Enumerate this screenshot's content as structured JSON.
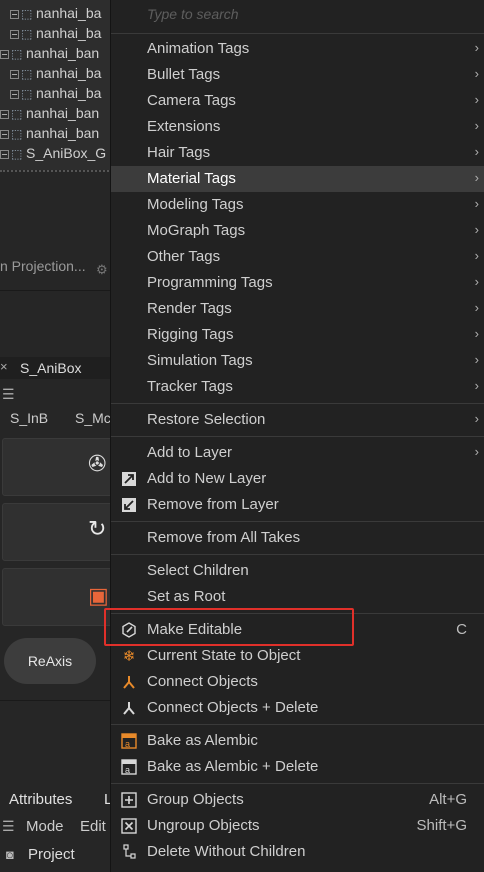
{
  "tree": {
    "rows": [
      {
        "label": "nanhai_ba",
        "indent": 1
      },
      {
        "label": "nanhai_ba",
        "indent": 1
      },
      {
        "label": "nanhai_ban",
        "indent": 0
      },
      {
        "label": "nanhai_ba",
        "indent": 1
      },
      {
        "label": "nanhai_ba",
        "indent": 1
      },
      {
        "label": "nanhai_ban",
        "indent": 0
      },
      {
        "label": "nanhai_ban",
        "indent": 0
      },
      {
        "label": "S_AniBox_G",
        "indent": 0
      }
    ],
    "projection_label": "n Projection..."
  },
  "left_panel": {
    "tab_label": "S_AniBox",
    "tab_close": "×",
    "sinb": "S_InB",
    "smo": "S_Mc",
    "reaxis": "ReAxis",
    "attributes_tab": "Attributes",
    "attributes_tab2": "L",
    "mode": "Mode",
    "edit": "Edit",
    "project": "Project"
  },
  "menu": {
    "search_placeholder": "Type to search",
    "groups": [
      {
        "label": "Animation Tags",
        "submenu": true
      },
      {
        "label": "Bullet Tags",
        "submenu": true
      },
      {
        "label": "Camera Tags",
        "submenu": true
      },
      {
        "label": "Extensions",
        "submenu": true
      },
      {
        "label": "Hair Tags",
        "submenu": true
      },
      {
        "label": "Material Tags",
        "submenu": true,
        "highlighted": true
      },
      {
        "label": "Modeling Tags",
        "submenu": true
      },
      {
        "label": "MoGraph Tags",
        "submenu": true
      },
      {
        "label": "Other Tags",
        "submenu": true
      },
      {
        "label": "Programming Tags",
        "submenu": true
      },
      {
        "label": "Render Tags",
        "submenu": true
      },
      {
        "label": "Rigging Tags",
        "submenu": true
      },
      {
        "label": "Simulation Tags",
        "submenu": true
      },
      {
        "label": "Tracker Tags",
        "submenu": true
      }
    ],
    "restore_selection": "Restore Selection",
    "add_to_layer": "Add to Layer",
    "add_to_new_layer": "Add to New Layer",
    "remove_from_layer": "Remove from Layer",
    "remove_from_all_takes": "Remove from All Takes",
    "select_children": "Select Children",
    "set_as_root": "Set as Root",
    "make_editable": "Make Editable",
    "make_editable_shortcut": "C",
    "current_state": "Current State to Object",
    "connect_objects": "Connect Objects",
    "connect_objects_delete": "Connect Objects + Delete",
    "bake_alembic": "Bake as Alembic",
    "bake_alembic_delete": "Bake as Alembic + Delete",
    "group_objects": "Group Objects",
    "group_shortcut": "Alt+G",
    "ungroup_objects": "Ungroup Objects",
    "ungroup_shortcut": "Shift+G",
    "delete_without_children": "Delete Without Children",
    "submenu_arrow": "›"
  },
  "colors": {
    "menu_bg": "#222222",
    "highlight_bg": "#3c3c3c",
    "annotation_red": "#e0302a",
    "icon_orange": "#e88a2a"
  }
}
